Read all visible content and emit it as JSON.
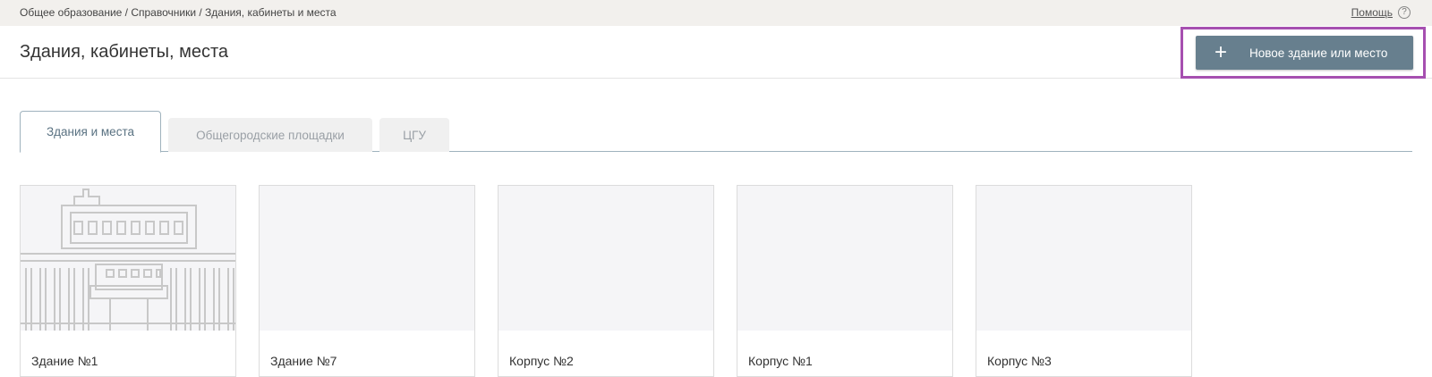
{
  "breadcrumb": "Общее образование / Справочники / Здания, кабинеты и места",
  "help": {
    "label": "Помощь",
    "icon": "help-circle-icon",
    "icon_glyph": "?"
  },
  "header": {
    "title": "Здания, кабинеты, места",
    "new_button": {
      "label": "Новое здание или место",
      "icon": "plus-icon",
      "icon_glyph": "+"
    }
  },
  "colors": {
    "accent_button": "#677f8e",
    "highlight_border": "#a64fb0",
    "active_tab_text": "#5a7282",
    "topbar": "#f2f0ed"
  },
  "tabs": [
    {
      "label": "Здания и места",
      "active": true
    },
    {
      "label": "Общегородские площадки",
      "active": false
    },
    {
      "label": "ЦГУ",
      "active": false
    }
  ],
  "cards": [
    {
      "name": "Здание №1",
      "image": "building-illustration"
    },
    {
      "name": "Здание №7",
      "image": "placeholder"
    },
    {
      "name": "Корпус №2",
      "image": "placeholder"
    },
    {
      "name": "Корпус №1",
      "image": "placeholder"
    },
    {
      "name": "Корпус №3",
      "image": "placeholder"
    }
  ]
}
